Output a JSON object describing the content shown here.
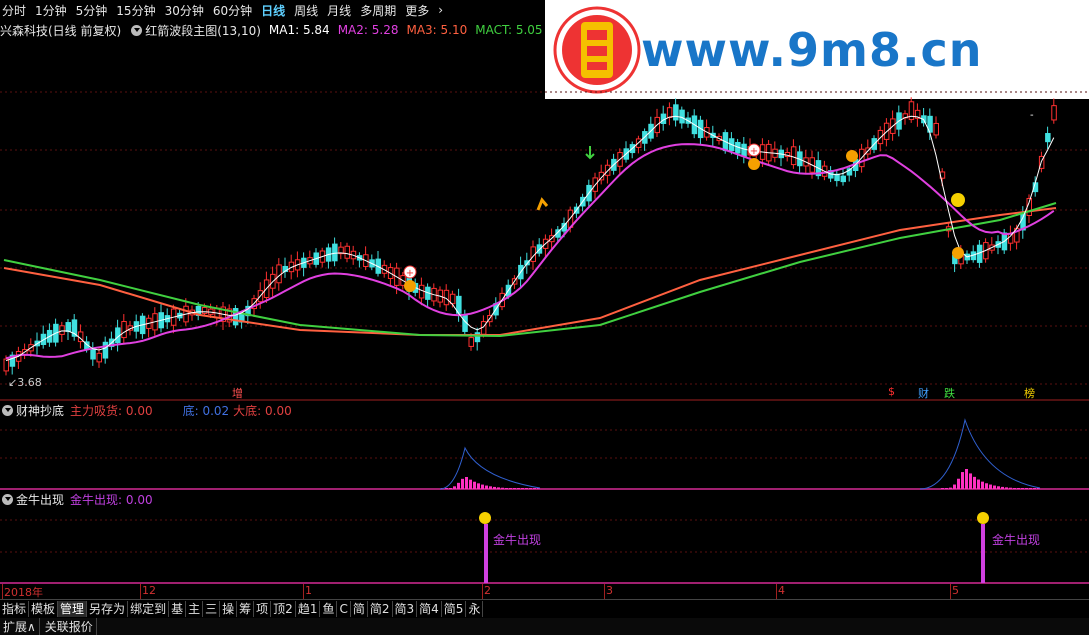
{
  "period_bar": {
    "items": [
      "分时",
      "1分钟",
      "5分钟",
      "15分钟",
      "30分钟",
      "60分钟",
      "日线",
      "周线",
      "月线",
      "多周期",
      "更多"
    ],
    "active": "日线",
    "more_arrow": "chevron-right-icon"
  },
  "main_panel": {
    "stock_name": "兴森科技(日线 前复权)",
    "indicator_name": "红箭波段主图(13,10)",
    "ma1": "MA1: 5.84",
    "ma2": "MA2: 5.28",
    "ma3": "MA3: 5.10",
    "mact": "MACT: 5.05",
    "low_price_label": "3.68",
    "signal_labels": {
      "zeng": "增",
      "s_mark": "$",
      "cai": "财",
      "die": "跌",
      "bang": "榜"
    }
  },
  "panel2": {
    "title": "财神抄底",
    "zhuli": "主力吸货: 0.00",
    "di": "底: 0.02",
    "dadi": "大底: 0.00"
  },
  "panel3": {
    "title": "金牛出现",
    "value": "金牛出现: 0.00",
    "signal_text": "金牛出现"
  },
  "date_axis": {
    "labels": [
      "2018年",
      "12",
      "1",
      "2",
      "3",
      "4",
      "5"
    ]
  },
  "toolbar": {
    "items": [
      "指标",
      "模板",
      "管理",
      "另存为",
      "绑定到",
      "基",
      "主",
      "三",
      "操",
      "筹",
      "项",
      "顶2",
      "趋1",
      "鱼",
      "C",
      "简",
      "简2",
      "简3",
      "简4",
      "简5",
      "永"
    ],
    "active": "管理"
  },
  "status_bar": {
    "expand": "扩展∧",
    "linked_quote": "关联报价"
  },
  "watermark": {
    "text": "www.9m8.cn",
    "logo_text": "9m8.cn"
  },
  "colors": {
    "ma1": "#ffffff",
    "ma2": "#e040e0",
    "ma3": "#ff6040",
    "mact": "#40d040",
    "up_candle": "#ff3030",
    "down_candle": "#40e0e0",
    "brand": "#1976c8",
    "panel_line": "#a02070"
  }
}
